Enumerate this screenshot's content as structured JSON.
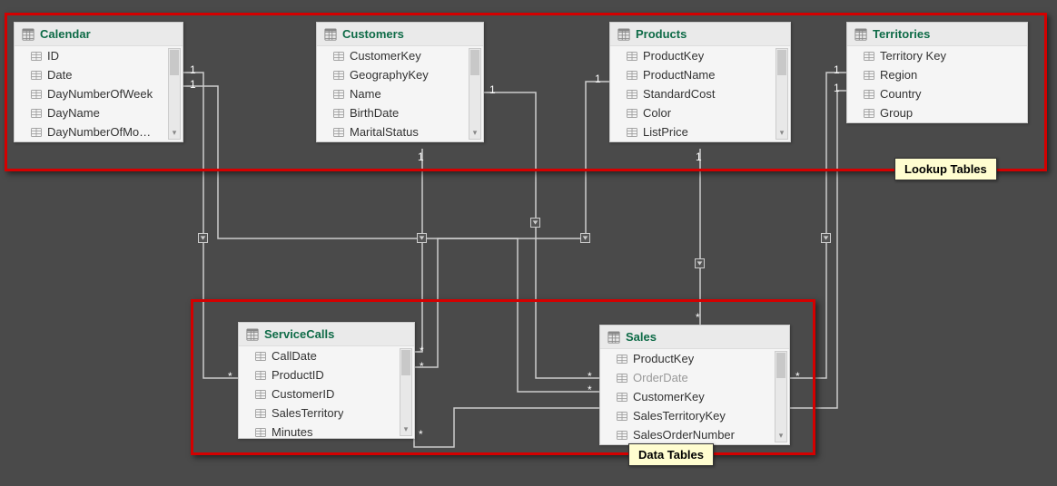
{
  "tables": {
    "calendar": {
      "name": "Calendar",
      "fields": [
        "ID",
        "Date",
        "DayNumberOfWeek",
        "DayName",
        "DayNumberOfMo…"
      ]
    },
    "customers": {
      "name": "Customers",
      "fields": [
        "CustomerKey",
        "GeographyKey",
        "Name",
        "BirthDate",
        "MaritalStatus"
      ]
    },
    "products": {
      "name": "Products",
      "fields": [
        "ProductKey",
        "ProductName",
        "StandardCost",
        "Color",
        "ListPrice"
      ]
    },
    "territories": {
      "name": "Territories",
      "fields": [
        "Territory Key",
        "Region",
        "Country",
        "Group"
      ]
    },
    "serviceCalls": {
      "name": "ServiceCalls",
      "fields": [
        "CallDate",
        "ProductID",
        "CustomerID",
        "SalesTerritory",
        "Minutes"
      ]
    },
    "sales": {
      "name": "Sales",
      "fields": [
        "ProductKey",
        "OrderDate",
        "CustomerKey",
        "SalesTerritoryKey",
        "SalesOrderNumber"
      ],
      "dimmed": [
        "OrderDate"
      ]
    }
  },
  "groups": {
    "lookup": "Lookup Tables",
    "data": "Data Tables"
  },
  "relationships": [
    {
      "from": "Calendar",
      "to": "ServiceCalls",
      "fromCard": "1",
      "toCard": "*"
    },
    {
      "from": "Calendar",
      "to": "Sales",
      "fromCard": "1",
      "toCard": "*"
    },
    {
      "from": "Customers",
      "to": "ServiceCalls",
      "fromCard": "1",
      "toCard": "*"
    },
    {
      "from": "Customers",
      "to": "Sales",
      "fromCard": "1",
      "toCard": "*"
    },
    {
      "from": "Products",
      "to": "ServiceCalls",
      "fromCard": "1",
      "toCard": "*"
    },
    {
      "from": "Products",
      "to": "Sales",
      "fromCard": "1",
      "toCard": "*"
    },
    {
      "from": "Territories",
      "to": "ServiceCalls",
      "fromCard": "1",
      "toCard": "*"
    },
    {
      "from": "Territories",
      "to": "Sales",
      "fromCard": "1",
      "toCard": "*"
    }
  ]
}
